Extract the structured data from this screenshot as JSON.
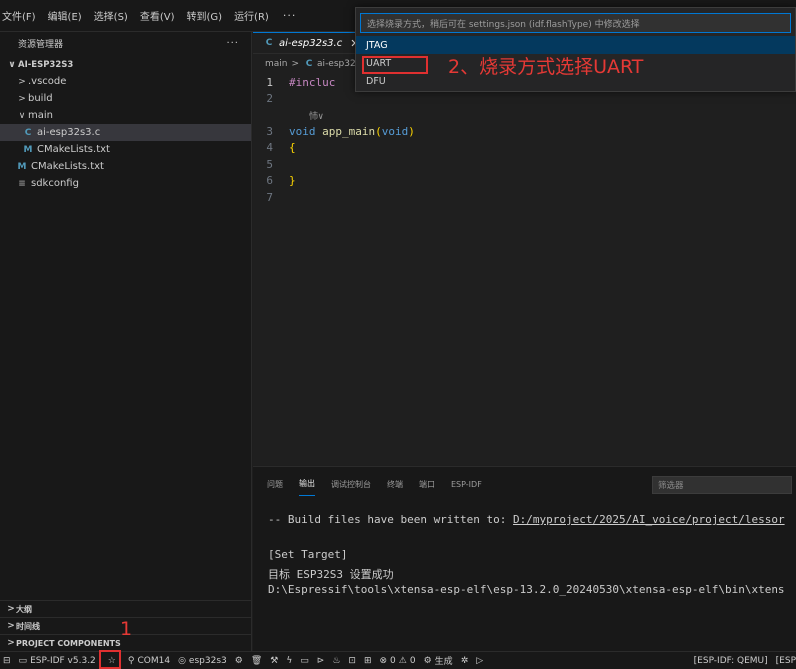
{
  "menubar": {
    "items": [
      "文件(F)",
      "编辑(E)",
      "选择(S)",
      "查看(V)",
      "转到(G)",
      "运行(R)"
    ],
    "more": "···"
  },
  "sidebar": {
    "title": "资源管理器",
    "more": "···",
    "root": "AI-ESP32S3",
    "items": [
      {
        "label": ".vscode",
        "chevron": ">"
      },
      {
        "label": "build",
        "chevron": ">"
      },
      {
        "label": "main",
        "chevron": "∨"
      },
      {
        "label": "ai-esp32s3.c",
        "icon": "C"
      },
      {
        "label": "CMakeLists.txt",
        "icon": "M"
      },
      {
        "label": "CMakeLists.txt",
        "icon": "M"
      },
      {
        "label": "sdkconfig",
        "icon": "≡"
      }
    ],
    "sections": [
      "大纲",
      "时间线",
      "PROJECT COMPONENTS"
    ]
  },
  "editor": {
    "tab_label": "ai-esp32s3.c",
    "tab_icon": "C",
    "tab_close": "✕",
    "breadcrumb": {
      "folder": "main",
      "sep": ">",
      "icon": "C",
      "file": "ai-esp32"
    },
    "code": {
      "line1_ln": "1",
      "line1_text": "#incluc",
      "line2_ln": "2",
      "codelens": "㤄∨",
      "line3_ln": "3",
      "line3_kw": "void",
      "line3_fn": "app_main",
      "line3_paren_open": "(",
      "line3_arg": "void",
      "line3_paren_close": ")",
      "line4_ln": "4",
      "line4_text": "{",
      "line5_ln": "5",
      "line6_ln": "6",
      "line6_text": "}",
      "line7_ln": "7"
    }
  },
  "quickpick": {
    "placeholder": "选择烧录方式，稍后可在 settings.json (idf.flashType) 中修改选择",
    "options": [
      "JTAG",
      "UART",
      "DFU"
    ]
  },
  "annotations": {
    "step2": "2、烧录方式选择UART",
    "step1": "1",
    "color": "#e53935"
  },
  "panel": {
    "tabs": [
      "问题",
      "输出",
      "调试控制台",
      "终端",
      "端口",
      "ESP-IDF"
    ],
    "active_tab": "输出",
    "filter_placeholder": "筛选器",
    "output": {
      "line1_prefix": "-- Build files have been written to: ",
      "line1_link": "D:/myproject/2025/AI_voice/project/lessor",
      "line2": "[Set Target]",
      "line3": "目标 ESP32S3 设置成功",
      "line4": "D:\\Espressif\\tools\\xtensa-esp-elf\\esp-13.2.0_20240530\\xtensa-esp-elf\\bin\\xtens"
    }
  },
  "statusbar": {
    "idf_version": "ESP-IDF v5.3.2",
    "port": "COM14",
    "target": "esp32s3",
    "problems": "0",
    "warnings": "0",
    "build_label": "生成",
    "right1": "[ESP-IDF: QEMU]",
    "right2": "[ESP"
  }
}
